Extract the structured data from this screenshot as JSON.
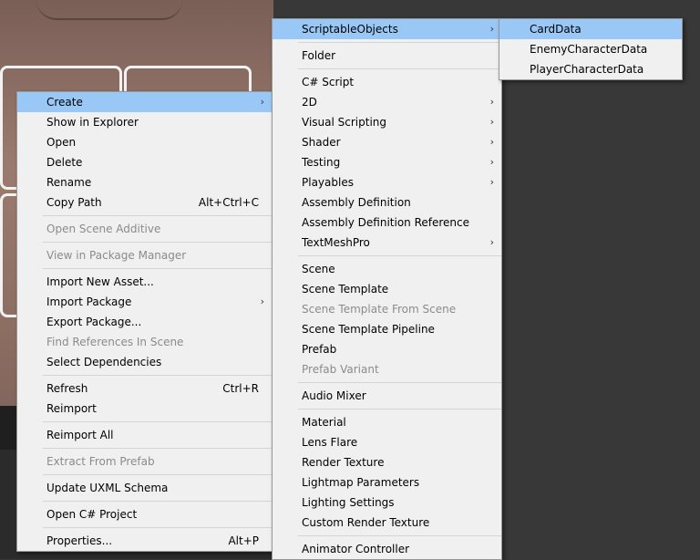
{
  "context_menu": {
    "items": [
      {
        "label": "Create",
        "shortcut": "",
        "submenu": true,
        "disabled": false,
        "highlighted": true
      },
      {
        "label": "Show in Explorer",
        "shortcut": "",
        "submenu": false,
        "disabled": false
      },
      {
        "label": "Open",
        "shortcut": "",
        "submenu": false,
        "disabled": false
      },
      {
        "label": "Delete",
        "shortcut": "",
        "submenu": false,
        "disabled": false
      },
      {
        "label": "Rename",
        "shortcut": "",
        "submenu": false,
        "disabled": false
      },
      {
        "label": "Copy Path",
        "shortcut": "Alt+Ctrl+C",
        "submenu": false,
        "disabled": false
      },
      {
        "separator": true
      },
      {
        "label": "Open Scene Additive",
        "shortcut": "",
        "submenu": false,
        "disabled": true
      },
      {
        "separator": true
      },
      {
        "label": "View in Package Manager",
        "shortcut": "",
        "submenu": false,
        "disabled": true
      },
      {
        "separator": true
      },
      {
        "label": "Import New Asset...",
        "shortcut": "",
        "submenu": false,
        "disabled": false
      },
      {
        "label": "Import Package",
        "shortcut": "",
        "submenu": true,
        "disabled": false
      },
      {
        "label": "Export Package...",
        "shortcut": "",
        "submenu": false,
        "disabled": false
      },
      {
        "label": "Find References In Scene",
        "shortcut": "",
        "submenu": false,
        "disabled": true
      },
      {
        "label": "Select Dependencies",
        "shortcut": "",
        "submenu": false,
        "disabled": false
      },
      {
        "separator": true
      },
      {
        "label": "Refresh",
        "shortcut": "Ctrl+R",
        "submenu": false,
        "disabled": false
      },
      {
        "label": "Reimport",
        "shortcut": "",
        "submenu": false,
        "disabled": false
      },
      {
        "separator": true
      },
      {
        "label": "Reimport All",
        "shortcut": "",
        "submenu": false,
        "disabled": false
      },
      {
        "separator": true
      },
      {
        "label": "Extract From Prefab",
        "shortcut": "",
        "submenu": false,
        "disabled": true
      },
      {
        "separator": true
      },
      {
        "label": "Update UXML Schema",
        "shortcut": "",
        "submenu": false,
        "disabled": false
      },
      {
        "separator": true
      },
      {
        "label": "Open C# Project",
        "shortcut": "",
        "submenu": false,
        "disabled": false
      },
      {
        "separator": true
      },
      {
        "label": "Properties...",
        "shortcut": "Alt+P",
        "submenu": false,
        "disabled": false
      }
    ]
  },
  "create_menu": {
    "items": [
      {
        "label": "ScriptableObjects",
        "submenu": true,
        "disabled": false,
        "highlighted": true
      },
      {
        "separator": true
      },
      {
        "label": "Folder",
        "submenu": false,
        "disabled": false
      },
      {
        "separator": true
      },
      {
        "label": "C# Script",
        "submenu": false,
        "disabled": false
      },
      {
        "label": "2D",
        "submenu": true,
        "disabled": false
      },
      {
        "label": "Visual Scripting",
        "submenu": true,
        "disabled": false
      },
      {
        "label": "Shader",
        "submenu": true,
        "disabled": false
      },
      {
        "label": "Testing",
        "submenu": true,
        "disabled": false
      },
      {
        "label": "Playables",
        "submenu": true,
        "disabled": false
      },
      {
        "label": "Assembly Definition",
        "submenu": false,
        "disabled": false
      },
      {
        "label": "Assembly Definition Reference",
        "submenu": false,
        "disabled": false
      },
      {
        "label": "TextMeshPro",
        "submenu": true,
        "disabled": false
      },
      {
        "separator": true
      },
      {
        "label": "Scene",
        "submenu": false,
        "disabled": false
      },
      {
        "label": "Scene Template",
        "submenu": false,
        "disabled": false
      },
      {
        "label": "Scene Template From Scene",
        "submenu": false,
        "disabled": true
      },
      {
        "label": "Scene Template Pipeline",
        "submenu": false,
        "disabled": false
      },
      {
        "label": "Prefab",
        "submenu": false,
        "disabled": false
      },
      {
        "label": "Prefab Variant",
        "submenu": false,
        "disabled": true
      },
      {
        "separator": true
      },
      {
        "label": "Audio Mixer",
        "submenu": false,
        "disabled": false
      },
      {
        "separator": true
      },
      {
        "label": "Material",
        "submenu": false,
        "disabled": false
      },
      {
        "label": "Lens Flare",
        "submenu": false,
        "disabled": false
      },
      {
        "label": "Render Texture",
        "submenu": false,
        "disabled": false
      },
      {
        "label": "Lightmap Parameters",
        "submenu": false,
        "disabled": false
      },
      {
        "label": "Lighting Settings",
        "submenu": false,
        "disabled": false
      },
      {
        "label": "Custom Render Texture",
        "submenu": false,
        "disabled": false
      },
      {
        "separator": true
      },
      {
        "label": "Animator Controller",
        "submenu": false,
        "disabled": false
      }
    ]
  },
  "scriptable_objects_menu": {
    "items": [
      {
        "label": "CardData",
        "highlighted": true
      },
      {
        "label": "EnemyCharacterData",
        "highlighted": false
      },
      {
        "label": "PlayerCharacterData",
        "highlighted": false
      }
    ]
  },
  "icons": {
    "submenu_arrow": "›"
  },
  "colors": {
    "highlight": "#99c8f6",
    "menu_bg": "#f0f0f0",
    "disabled_text": "#8b8b8b",
    "editor_bg": "#383838"
  }
}
